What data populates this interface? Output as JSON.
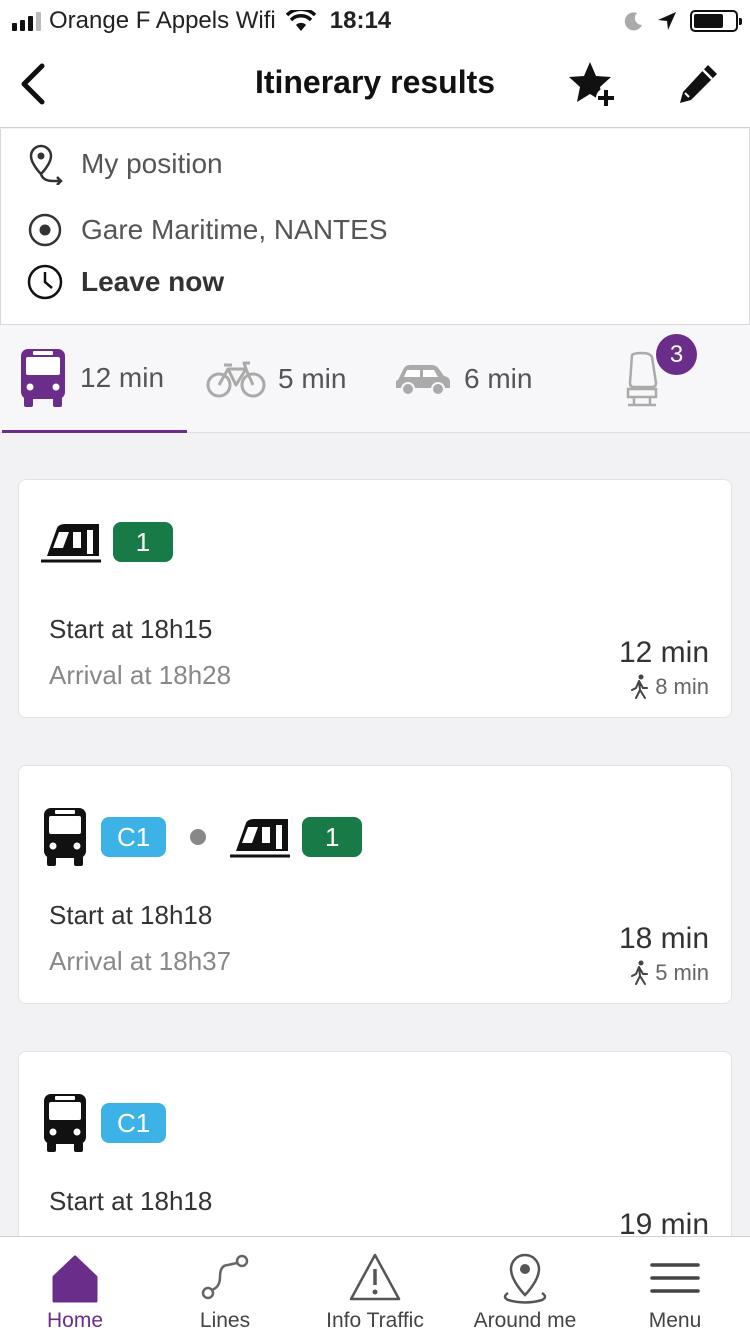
{
  "status_bar": {
    "carrier": "Orange F Appels Wifi",
    "time": "18:14"
  },
  "header": {
    "title": "Itinerary results",
    "icons": [
      "back-icon",
      "favorite-add-icon",
      "edit-icon"
    ]
  },
  "search": {
    "origin": "My position",
    "destination": "Gare Maritime, NANTES",
    "departure": "Leave now"
  },
  "modes": {
    "transit": "12 min",
    "bike": "5 min",
    "car": "6 min",
    "options_badge": "3"
  },
  "results": [
    {
      "lines": [
        "1"
      ],
      "start": "Start at 18h15",
      "arrival": "Arrival at 18h28",
      "duration": "12 min",
      "walk": "8 min"
    },
    {
      "lines": [
        "C1",
        "1"
      ],
      "start": "Start at 18h18",
      "arrival": "Arrival at 18h37",
      "duration": "18 min",
      "walk": "5 min"
    },
    {
      "lines": [
        "C1"
      ],
      "start": "Start at 18h18",
      "duration": "19 min"
    }
  ],
  "colors": {
    "accent": "#6b2d8a",
    "tram_line": "#187a47",
    "bus_line": "#3db2e6"
  },
  "nav": {
    "home": "Home",
    "lines": "Lines",
    "traffic": "Info Traffic",
    "around": "Around me",
    "menu": "Menu"
  }
}
